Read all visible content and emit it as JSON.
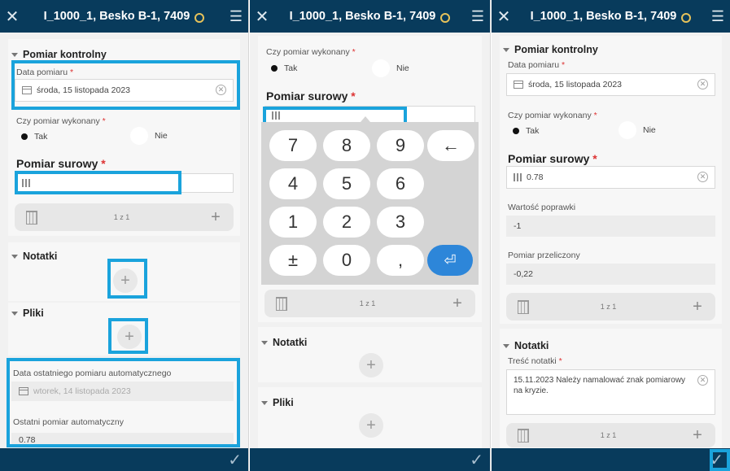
{
  "titlebar": {
    "title": "I_1000_1, Besko B-1, 7409",
    "close_glyph": "✕",
    "menu_glyph": "☰",
    "icon": "gps-icon"
  },
  "submit_glyph": "✓",
  "accent_color": "#1aa3dc",
  "header_color": "#083b5c",
  "panel1": {
    "section_title": "Pomiar kontrolny",
    "date_label": "Data pomiaru",
    "required_mark": "*",
    "date_value": "środa, 15 listopada 2023",
    "done_label": "Czy pomiar wykonany",
    "option_yes": "Tak",
    "option_no": "Nie",
    "raw_label": "Pomiar surowy",
    "raw_value": "",
    "counter": "1 z 1",
    "notes_title": "Notatki",
    "files_title": "Pliki",
    "last_auto_date_label": "Data ostatniego pomiaru automatycznego",
    "last_auto_date_value": "wtorek, 14 listopada 2023",
    "last_auto_label": "Ostatni pomiar automatyczny",
    "last_auto_value": "0.78"
  },
  "panel2": {
    "done_label": "Czy pomiar wykonany",
    "option_yes": "Tak",
    "option_no": "Nie",
    "raw_label": "Pomiar surowy",
    "keys": [
      "7",
      "8",
      "9",
      "←",
      "4",
      "5",
      "6",
      "1",
      "2",
      "3",
      "±",
      "0",
      ",",
      "⏎"
    ],
    "counter": "1 z 1",
    "notes_title": "Notatki",
    "files_title": "Pliki"
  },
  "panel3": {
    "section_title": "Pomiar kontrolny",
    "date_label": "Data pomiaru",
    "date_value": "środa, 15 listopada 2023",
    "done_label": "Czy pomiar wykonany",
    "option_yes": "Tak",
    "option_no": "Nie",
    "raw_label": "Pomiar surowy",
    "raw_value": "0.78",
    "correction_label": "Wartość poprawki",
    "correction_value": "-1",
    "converted_label": "Pomiar przeliczony",
    "converted_value": "-0,22",
    "counter": "1 z 1",
    "notes_title": "Notatki",
    "note_label": "Treść notatki",
    "note_value": "15.11.2023 Należy namalować znak pomiarowy na kryzie.",
    "counter2": "1 z 1"
  }
}
